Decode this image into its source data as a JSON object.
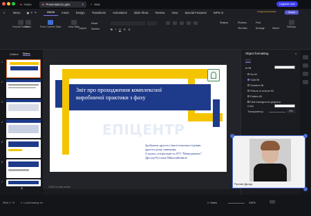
{
  "tabs": [
    {
      "label": "Home"
    },
    {
      "label": "Presentation1.pptx"
    },
    {
      "label": "New"
    }
  ],
  "topright": {
    "upgrade": "Upgrade now"
  },
  "menu": {
    "file": "Menu",
    "items": [
      "Home",
      "Insert",
      "Design",
      "Transitions",
      "Animations",
      "Slide Show",
      "Review",
      "View",
      "Special Features",
      "WPS AI"
    ],
    "active": "Home",
    "share": "Share",
    "unsync": "Unsynchronized"
  },
  "toolbar": {
    "format_painter": "Format Painter",
    "paste": "Paste",
    "from_current": "From Current Slide",
    "new_slide": "New Slide",
    "layout": "Layout",
    "reset": "Reset",
    "section": "Section",
    "shapes": "Shapes",
    "picture": "Pictures",
    "find": "Find",
    "text_box": "Text Box",
    "arrange": "Arrange",
    "select": "Select",
    "settings": "Settings"
  },
  "left": {
    "tabs": [
      "Outline",
      "Slides"
    ],
    "active": "Slides",
    "add": "+",
    "numbers": [
      "1",
      "2",
      "3",
      "4",
      "5",
      "6",
      "7"
    ]
  },
  "slide": {
    "title_line1": "Звіт про проходження комплексної",
    "title_line2": "виробничої практики з фаху",
    "watermark": "ЕПІЦЕНТР",
    "info1": "Здобувача другого (магістерського) рівня",
    "info2": "другого року навчання,",
    "info3": "4 групи, спеціальність 073 \"Менеджмент\"",
    "info4": "Дрозда Руслана Миколайовича",
    "notes": "Click to add notes"
  },
  "panel": {
    "title": "Object formatting",
    "fill_section": "Fill",
    "options": [
      "No fill",
      "Solid fill",
      "Gradient fill",
      "Picture or texture fill",
      "Pattern fill",
      "Hide background graphics"
    ],
    "selected": "Solid fill",
    "color_label": "Color",
    "transparency_label": "Transparency",
    "transparency_value": "0%",
    "apply_all": "Apply to All",
    "reset_bg": "Reset Background"
  },
  "camera": {
    "name": "Руслан Дрозд"
  },
  "status": {
    "slide": "Slide 1 / 5",
    "backup": "Local backup on",
    "notes": "Notes",
    "zoom": "134%"
  },
  "colors": {
    "accent": "#7b7bf0",
    "navy": "#1e3a8a",
    "yellow": "#f5c400"
  }
}
